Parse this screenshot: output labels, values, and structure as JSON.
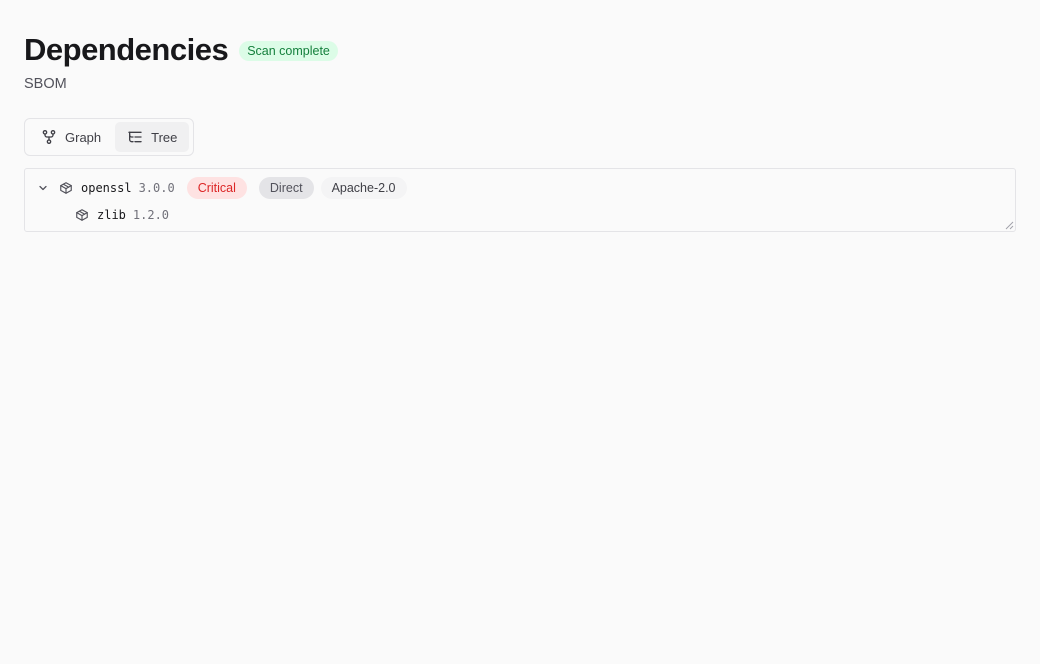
{
  "header": {
    "title": "Dependencies",
    "status_badge": "Scan complete",
    "subtitle": "SBOM"
  },
  "view_toggle": {
    "options": [
      {
        "label": "Graph",
        "icon": "git-fork-icon",
        "active": false
      },
      {
        "label": "Tree",
        "icon": "list-tree-icon",
        "active": true
      }
    ]
  },
  "tree": {
    "root": {
      "name": "openssl",
      "version": "3.0.0",
      "severity": "Critical",
      "relation": "Direct",
      "license": "Apache-2.0",
      "icon": "package-icon",
      "expanded": true
    },
    "children": [
      {
        "name": "zlib",
        "version": "1.2.0",
        "icon": "package-icon"
      }
    ]
  },
  "colors": {
    "critical_text": "#dc2626",
    "critical_bg": "#fee2e2",
    "success_text": "#15803d",
    "success_bg": "#dcfce7"
  }
}
